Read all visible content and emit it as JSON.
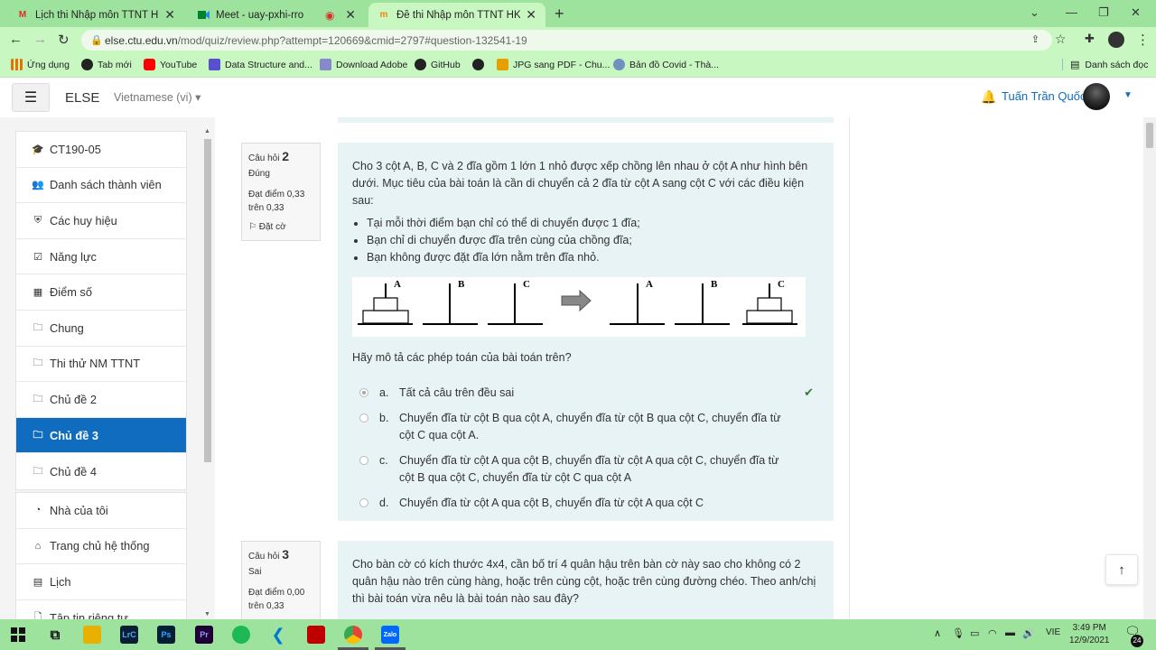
{
  "browser": {
    "tabs": [
      {
        "title": "Lịch thi Nhập môn TTNT HK1 202",
        "icon": "gmail-icon",
        "active": false
      },
      {
        "title": "Meet - uay-pxhi-rro",
        "icon": "meet-icon",
        "active": false
      },
      {
        "title": "Đề thi Nhập môn TTNT HKI năm",
        "icon": "moodle-icon",
        "active": true
      }
    ],
    "url_host": "else.ctu.edu.vn",
    "url_path": "/mod/quiz/review.php?attempt=120669&cmid=2797#question-132541-19",
    "bookmarks": [
      {
        "label": "Ứng dụng",
        "icon": "apps-icon",
        "color": "#e37400"
      },
      {
        "label": "Tab mới",
        "icon": "globe-icon",
        "color": "#222222"
      },
      {
        "label": "YouTube",
        "icon": "youtube-icon",
        "color": "#ff0000"
      },
      {
        "label": "Data Structure and...",
        "icon": "bookmark-icon",
        "color": "#5a4fcf"
      },
      {
        "label": "Download Adobe",
        "icon": "bookmark-icon",
        "color": "#8888cc"
      },
      {
        "label": "GitHub",
        "icon": "github-icon",
        "color": "#222222"
      },
      {
        "label": "",
        "icon": "globe-icon",
        "color": "#222222"
      },
      {
        "label": "JPG sang PDF - Chu...",
        "icon": "bookmark-icon",
        "color": "#e8a000"
      },
      {
        "label": "Bản đồ Covid - Thà...",
        "icon": "bookmark-icon",
        "color": "#7090c0"
      }
    ],
    "reading_list": "Danh sách đọc"
  },
  "header": {
    "brand": "ELSE",
    "language": "Vietnamese (vi) ▾",
    "user_name": "Tuấn Trần Quốc"
  },
  "drawer": {
    "group1": [
      {
        "label": "CT190-05",
        "icon": "graduation-cap-icon"
      },
      {
        "label": "Danh sách thành viên",
        "icon": "users-icon"
      },
      {
        "label": "Các huy hiệu",
        "icon": "shield-icon"
      },
      {
        "label": "Năng lực",
        "icon": "checkbox-icon"
      },
      {
        "label": "Điểm số",
        "icon": "table-icon"
      },
      {
        "label": "Chung",
        "icon": "folder-icon"
      },
      {
        "label": "Thi thử NM TTNT",
        "icon": "folder-icon"
      },
      {
        "label": "Chủ đề 2",
        "icon": "folder-icon"
      },
      {
        "label": "Chủ đề 3",
        "icon": "folder-icon",
        "active": true
      },
      {
        "label": "Chủ đề 4",
        "icon": "folder-icon"
      }
    ],
    "group2": [
      {
        "label": "Nhà của tôi",
        "icon": "dashboard-icon"
      },
      {
        "label": "Trang chủ hệ thống",
        "icon": "home-icon"
      },
      {
        "label": "Lịch",
        "icon": "calendar-icon"
      },
      {
        "label": "Tập tin riêng tư",
        "icon": "file-icon"
      }
    ]
  },
  "questions": [
    {
      "label": "Câu hỏi",
      "number": "2",
      "status": "Đúng",
      "mark": "Đạt điểm 0,33 trên 0,33",
      "flag": "Đặt cờ",
      "text": "Cho 3 cột A, B, C và 2 đĩa gồm 1 lớn 1 nhỏ được xếp chồng lên nhau ở cột A như hình bên dưới. Mục tiêu của bài toán là cần di chuyển cả 2 đĩa từ cột A sang cột C với các điều kiện sau:",
      "rules": [
        "Tại mỗi thời điểm bạn chỉ có thể di chuyển được 1 đĩa;",
        "Bạn chỉ di chuyển được đĩa trên cùng của chồng đĩa;",
        "Bạn không được đặt đĩa lớn nằm trên đĩa nhỏ."
      ],
      "figure_labels": [
        "A",
        "B",
        "C",
        "A",
        "B",
        "C"
      ],
      "prompt": "Hãy mô tả các phép toán của bài toán trên?",
      "options": [
        {
          "letter": "a.",
          "text": "Tất cả câu trên đều sai",
          "selected": true,
          "correct": true
        },
        {
          "letter": "b.",
          "text": "Chuyển đĩa từ cột B qua cột A, chuyển đĩa từ cột B qua cột C, chuyển đĩa từ cột C qua cột A.",
          "selected": false
        },
        {
          "letter": "c.",
          "text": "Chuyển đĩa từ cột A qua cột B, chuyển đĩa từ cột A qua cột C, chuyển đĩa từ cột B qua cột C, chuyển đĩa từ cột C qua cột A",
          "selected": false
        },
        {
          "letter": "d.",
          "text": "Chuyển đĩa từ cột A qua cột B, chuyển đĩa từ cột A qua cột C",
          "selected": false
        }
      ]
    },
    {
      "label": "Câu hỏi",
      "number": "3",
      "status": "Sai",
      "mark": "Đạt điểm 0,00 trên 0,33",
      "text": "Cho bàn cờ có kích thước 4x4, cần bố trí 4 quân hậu trên bàn cờ này sao cho không có 2 quân hậu nào trên cùng hàng, hoặc trên cùng cột, hoặc trên cùng đường chéo. Theo anh/chị thì bài toán vừa nêu là bài toán nào sau đây?"
    }
  ],
  "taskbar": {
    "apps": [
      {
        "name": "start-icon",
        "label": "",
        "color": "#1b1b1b"
      },
      {
        "name": "task-view-icon",
        "label": "",
        "color": "#1b1b1b"
      },
      {
        "name": "file-explorer-icon",
        "label": "",
        "color": "#e8b000"
      },
      {
        "name": "lightroom-classic-icon",
        "label": "LrC",
        "color": "#0a1e36"
      },
      {
        "name": "photoshop-icon",
        "label": "Ps",
        "color": "#001e36"
      },
      {
        "name": "premiere-icon",
        "label": "Pr",
        "color": "#1e0036"
      },
      {
        "name": "spotify-icon",
        "label": "",
        "color": "#1db954"
      },
      {
        "name": "vscode-icon",
        "label": "",
        "color": "#0078d4"
      },
      {
        "name": "garena-icon",
        "label": "",
        "color": "#c00000"
      },
      {
        "name": "chrome-icon",
        "label": "",
        "color": "#4285f4"
      },
      {
        "name": "zalo-icon",
        "label": "Zalo",
        "color": "#0068ff"
      }
    ],
    "lang": "VIE",
    "time": "3:49 PM",
    "date": "12/9/2021",
    "notifications": "24"
  }
}
